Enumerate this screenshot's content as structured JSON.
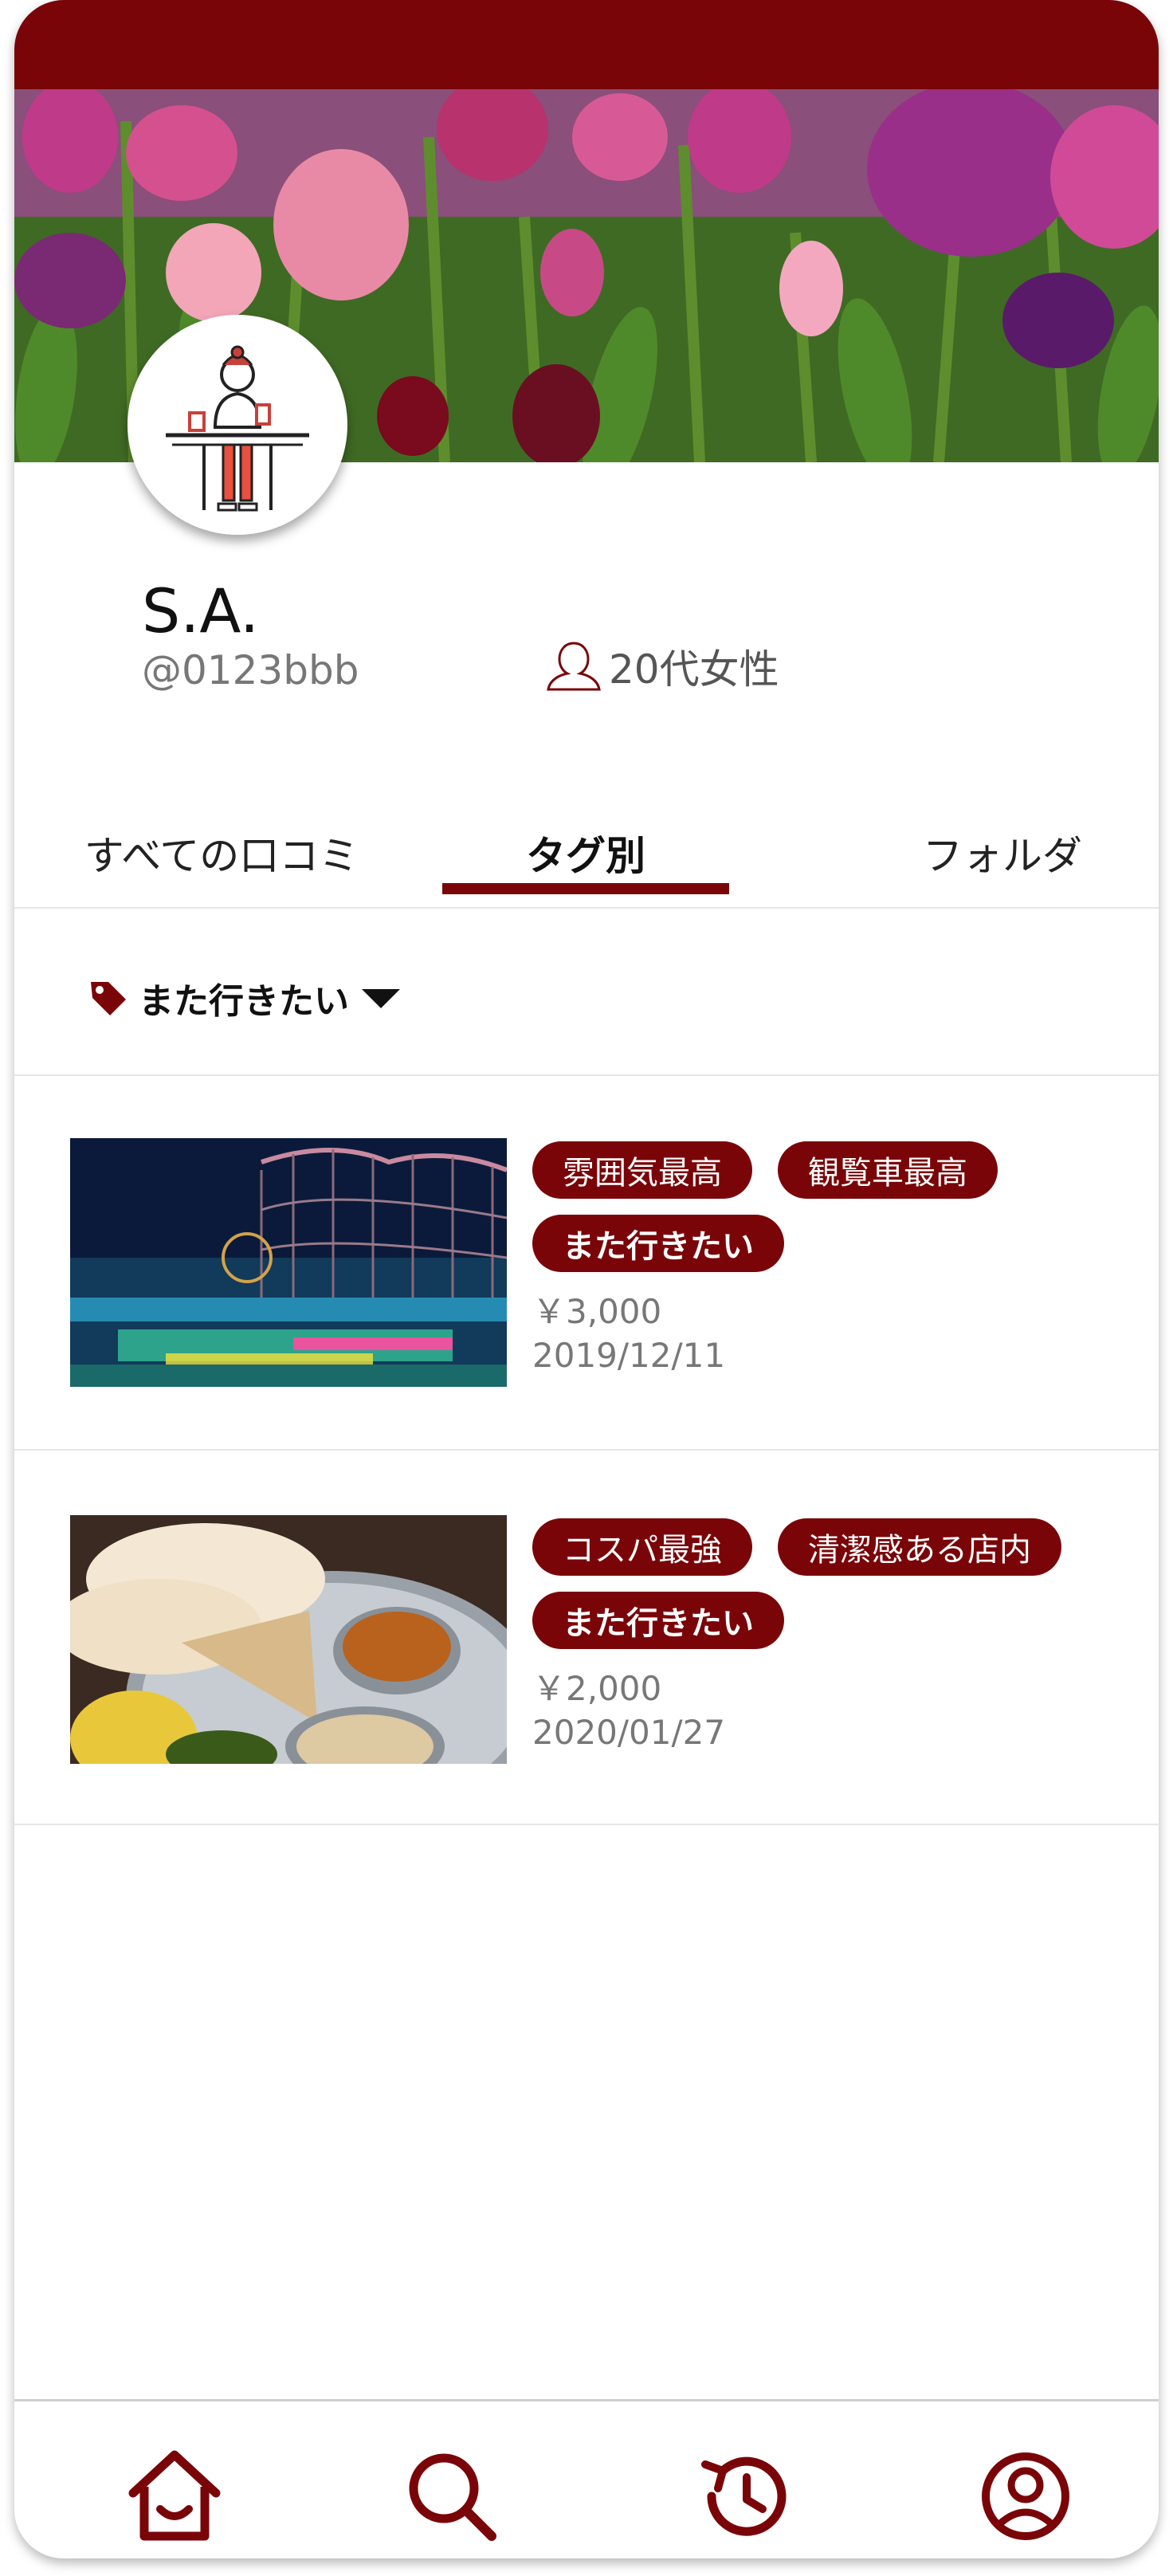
{
  "profile": {
    "display_name": "S.A.",
    "handle": "@0123bbb",
    "demographic": "20代女性"
  },
  "tabs": [
    {
      "label": "すべての口コミ",
      "active": false
    },
    {
      "label": "タグ別",
      "active": true
    },
    {
      "label": "フォルダ",
      "active": false
    }
  ],
  "filter": {
    "selected": "また行きたい"
  },
  "reviews": [
    {
      "image": "amusement-park-illumination",
      "tags": [
        "雰囲気最高",
        "観覧車最高",
        "また行きたい"
      ],
      "price": "￥3,000",
      "date": "2019/12/11"
    },
    {
      "image": "curry-and-naan-plate",
      "tags": [
        "コスパ最強",
        "清潔感ある店内",
        "また行きたい"
      ],
      "price": "￥2,000",
      "date": "2020/01/27"
    }
  ],
  "bottom_nav": [
    "home-icon",
    "search-icon",
    "history-icon",
    "account-icon"
  ],
  "colors": {
    "accent": "#7a0508",
    "text_muted": "#777777"
  }
}
